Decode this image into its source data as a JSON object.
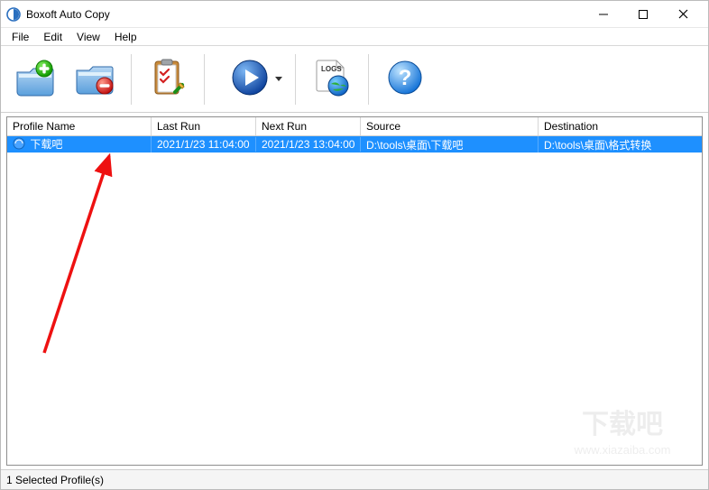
{
  "window": {
    "title": "Boxoft Auto Copy"
  },
  "menu": {
    "items": [
      "File",
      "Edit",
      "View",
      "Help"
    ]
  },
  "toolbar": {
    "icons": [
      "folder-add-icon",
      "folder-remove-icon",
      "clipboard-check-icon",
      "run-play-icon",
      "logs-world-icon",
      "help-question-icon"
    ]
  },
  "columns": {
    "c0": "Profile Name",
    "c1": "Last Run",
    "c2": "Next Run",
    "c3": "Source",
    "c4": "Destination"
  },
  "rows": [
    {
      "name": "下载吧",
      "last_run": "2021/1/23 11:04:00",
      "next_run": "2021/1/23 13:04:00",
      "source": "D:\\tools\\桌面\\下载吧",
      "destination": "D:\\tools\\桌面\\格式转换",
      "selected": true
    }
  ],
  "status": {
    "text": "1 Selected Profile(s)"
  },
  "watermark": {
    "text_cn": "下载吧",
    "text_url": "www.xiazaiba.com"
  }
}
